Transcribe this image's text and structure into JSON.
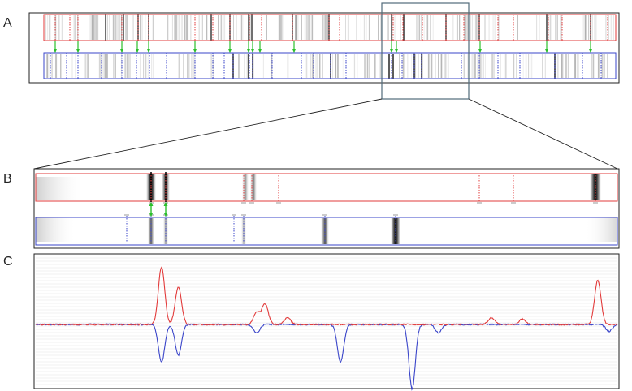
{
  "labels": {
    "a": "A",
    "b": "B",
    "c": "C"
  },
  "colors": {
    "red_track": "#e23b3b",
    "blue_track": "#3a45c9",
    "link": "#2bbf2b",
    "zoom_box": "#506a7a",
    "frame": "#222222",
    "grid": "#e6e6e6"
  },
  "panel_c": {
    "red_peaks": [
      {
        "pos": 0.225,
        "amp": 0.85
      },
      {
        "pos": 0.255,
        "amp": 0.55
      },
      {
        "pos": 0.395,
        "amp": 0.18
      },
      {
        "pos": 0.41,
        "amp": 0.3
      },
      {
        "pos": 0.45,
        "amp": 0.1
      },
      {
        "pos": 0.815,
        "amp": 0.1
      },
      {
        "pos": 0.87,
        "amp": 0.08
      },
      {
        "pos": 1.005,
        "amp": 0.65
      }
    ],
    "blue_peaks": [
      {
        "pos": 0.225,
        "amp": 0.55
      },
      {
        "pos": 0.255,
        "amp": 0.45
      },
      {
        "pos": 0.395,
        "amp": 0.12
      },
      {
        "pos": 0.545,
        "amp": 0.55
      },
      {
        "pos": 0.673,
        "amp": 0.95
      },
      {
        "pos": 0.72,
        "amp": 0.12
      },
      {
        "pos": 1.025,
        "amp": 0.1
      }
    ]
  }
}
